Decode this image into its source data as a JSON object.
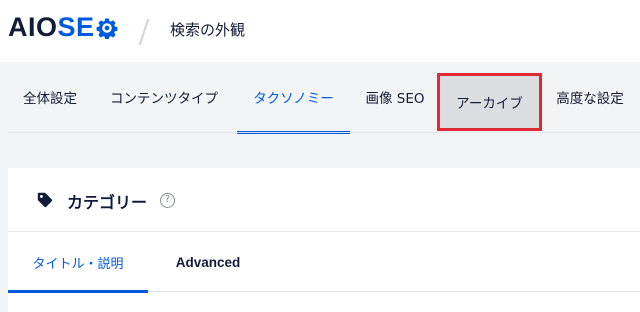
{
  "header": {
    "logo_aio": "AIO",
    "logo_seo": "SE",
    "page_title": "検索の外観"
  },
  "tabs": [
    {
      "label": "全体設定",
      "active": false
    },
    {
      "label": "コンテンツタイプ",
      "active": false
    },
    {
      "label": "タクソノミー",
      "active": true
    },
    {
      "label": "画像 SEO",
      "active": false
    },
    {
      "label": "アーカイブ",
      "active": false,
      "highlighted": true
    },
    {
      "label": "高度な設定",
      "active": false
    }
  ],
  "card": {
    "title": "カテゴリー",
    "help_glyph": "?",
    "subtabs": [
      {
        "label": "タイトル・説明",
        "active": true
      },
      {
        "label": "Advanced",
        "active": false
      }
    ]
  },
  "colors": {
    "accent": "#005ae0",
    "highlight_border": "#df2a35",
    "text": "#141b38"
  },
  "icons": {
    "logo": "gear-icon",
    "card": "tag-icon",
    "help": "help-circle-icon"
  }
}
